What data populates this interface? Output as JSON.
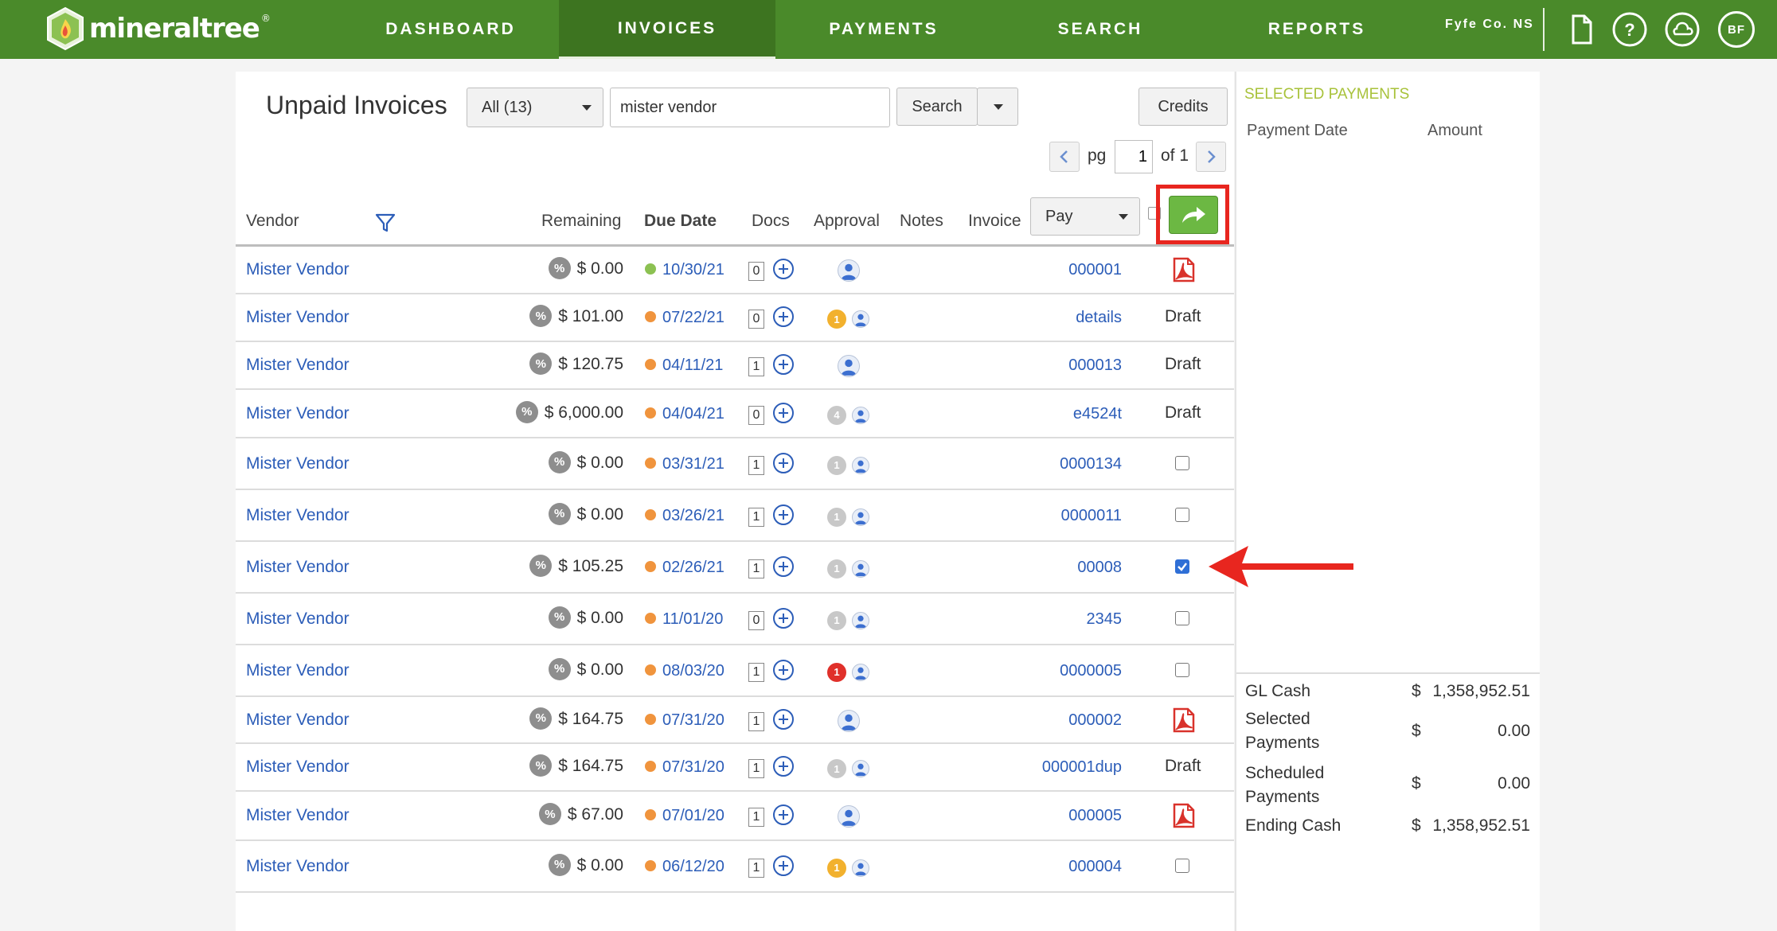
{
  "app": {
    "logo_text": "mineraltree",
    "company": "Fyfe Co. NS",
    "user_initials": "BF"
  },
  "nav": {
    "items": [
      {
        "label": "DASHBOARD",
        "active": false
      },
      {
        "label": "INVOICES",
        "active": true
      },
      {
        "label": "PAYMENTS",
        "active": false
      },
      {
        "label": "SEARCH",
        "active": false
      },
      {
        "label": "REPORTS",
        "active": false
      }
    ]
  },
  "toolbar": {
    "title": "Unpaid Invoices",
    "filter_selected": "All (13)",
    "search_value": "mister vendor",
    "search_label": "Search",
    "credits_label": "Credits"
  },
  "pager": {
    "pg_label": "pg",
    "page": "1",
    "of_label": "of 1"
  },
  "columns": {
    "vendor": "Vendor",
    "remaining": "Remaining",
    "due_date": "Due Date",
    "docs": "Docs",
    "approval": "Approval",
    "notes": "Notes",
    "invoice": "Invoice",
    "action_selected": "Pay"
  },
  "rows": [
    {
      "vendor": "Mister Vendor",
      "remaining": "$ 0.00",
      "status_color": "#8cc152",
      "due": "10/30/21",
      "docs": "0",
      "approval": "user",
      "badge": "",
      "invoice": "000001",
      "action": "pdf"
    },
    {
      "vendor": "Mister Vendor",
      "remaining": "$ 101.00",
      "status_color": "#f0943d",
      "due": "07/22/21",
      "docs": "0",
      "approval": "badge",
      "badge": "1",
      "badge_color": "#f2b12e",
      "invoice": "details",
      "action": "Draft"
    },
    {
      "vendor": "Mister Vendor",
      "remaining": "$ 120.75",
      "status_color": "#f0943d",
      "due": "04/11/21",
      "docs": "1",
      "approval": "user",
      "badge": "",
      "invoice": "000013",
      "action": "Draft"
    },
    {
      "vendor": "Mister Vendor",
      "remaining": "$ 6,000.00",
      "status_color": "#f0943d",
      "due": "04/04/21",
      "docs": "0",
      "approval": "badge",
      "badge": "4",
      "badge_color": "#c8c8c8",
      "invoice": "e4524t",
      "action": "Draft"
    },
    {
      "vendor": "Mister Vendor",
      "remaining": "$ 0.00",
      "status_color": "#f0943d",
      "due": "03/31/21",
      "docs": "1",
      "approval": "badge",
      "badge": "1",
      "badge_color": "#c8c8c8",
      "invoice": "0000134",
      "action": "checkbox",
      "checked": false
    },
    {
      "vendor": "Mister Vendor",
      "remaining": "$ 0.00",
      "status_color": "#f0943d",
      "due": "03/26/21",
      "docs": "1",
      "approval": "badge",
      "badge": "1",
      "badge_color": "#c8c8c8",
      "invoice": "0000011",
      "action": "checkbox",
      "checked": false
    },
    {
      "vendor": "Mister Vendor",
      "remaining": "$ 105.25",
      "status_color": "#f0943d",
      "due": "02/26/21",
      "docs": "1",
      "approval": "badge",
      "badge": "1",
      "badge_color": "#c8c8c8",
      "invoice": "00008",
      "action": "checkbox",
      "checked": true
    },
    {
      "vendor": "Mister Vendor",
      "remaining": "$ 0.00",
      "status_color": "#f0943d",
      "due": "11/01/20",
      "docs": "0",
      "approval": "badge",
      "badge": "1",
      "badge_color": "#c8c8c8",
      "invoice": "2345",
      "action": "checkbox",
      "checked": false
    },
    {
      "vendor": "Mister Vendor",
      "remaining": "$ 0.00",
      "status_color": "#f0943d",
      "due": "08/03/20",
      "docs": "1",
      "approval": "badge",
      "badge": "1",
      "badge_color": "#e0302a",
      "invoice": "0000005",
      "action": "checkbox",
      "checked": false
    },
    {
      "vendor": "Mister Vendor",
      "remaining": "$ 164.75",
      "status_color": "#f0943d",
      "due": "07/31/20",
      "docs": "1",
      "approval": "user",
      "badge": "",
      "invoice": "000002",
      "action": "pdf"
    },
    {
      "vendor": "Mister Vendor",
      "remaining": "$ 164.75",
      "status_color": "#f0943d",
      "due": "07/31/20",
      "docs": "1",
      "approval": "badge",
      "badge": "1",
      "badge_color": "#c8c8c8",
      "invoice": "000001dup",
      "action": "Draft"
    },
    {
      "vendor": "Mister Vendor",
      "remaining": "$ 67.00",
      "status_color": "#f0943d",
      "due": "07/01/20",
      "docs": "1",
      "approval": "user",
      "badge": "",
      "invoice": "000005",
      "action": "pdf"
    },
    {
      "vendor": "Mister Vendor",
      "remaining": "$ 0.00",
      "status_color": "#f0943d",
      "due": "06/12/20",
      "docs": "1",
      "approval": "badge",
      "badge": "1",
      "badge_color": "#f2b12e",
      "invoice": "000004",
      "action": "checkbox",
      "checked": false
    }
  ],
  "selected_payments": {
    "title": "SELECTED PAYMENTS",
    "col_date": "Payment Date",
    "col_amount": "Amount"
  },
  "summary": [
    {
      "label": "GL Cash",
      "dollar": "$",
      "value": "1,358,952.51"
    },
    {
      "label": "Selected Payments",
      "dollar": "$",
      "value": "0.00"
    },
    {
      "label": "Scheduled Payments",
      "dollar": "$",
      "value": "0.00"
    },
    {
      "label": "Ending Cash",
      "dollar": "$",
      "value": "1,358,952.51"
    }
  ],
  "colors": {
    "brand_green": "#4a8a2a",
    "link_blue": "#2c5db8",
    "highlight_red": "#e8261f"
  }
}
